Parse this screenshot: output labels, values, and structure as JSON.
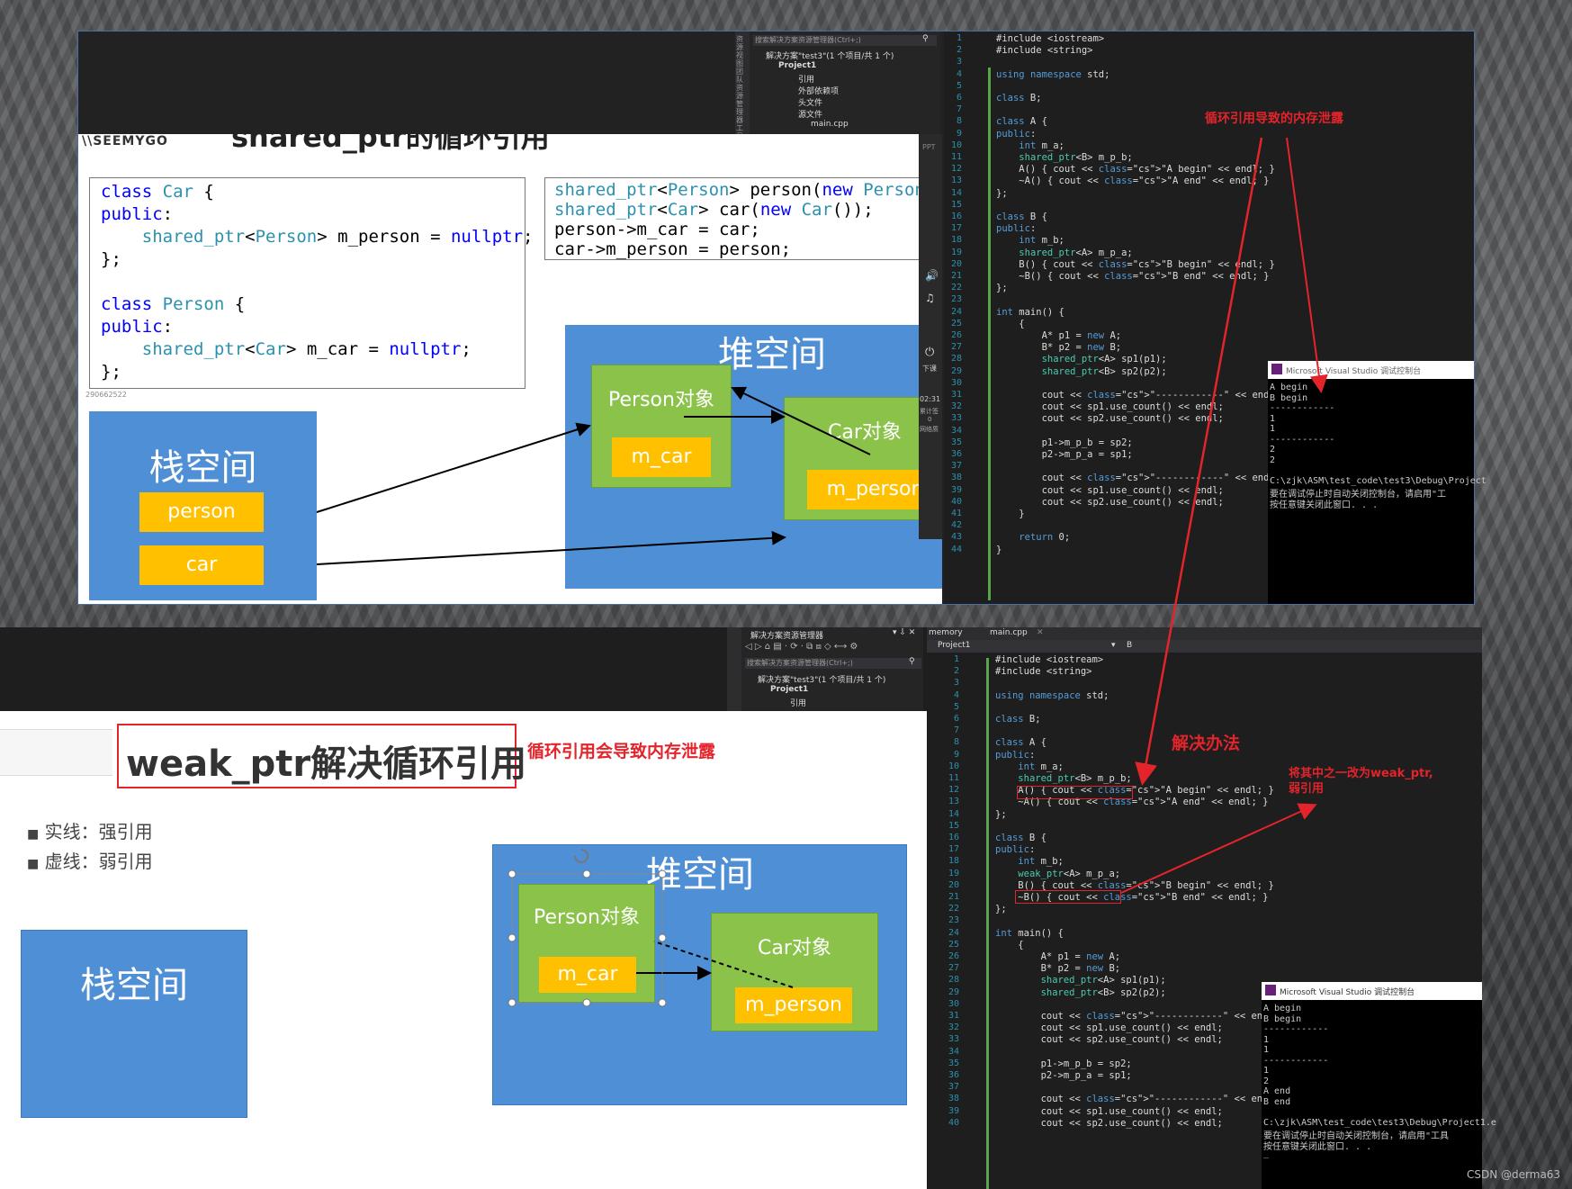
{
  "top": {
    "slide": {
      "title_fragment": "shared_ptr的循环引用",
      "watermark": "\\\\SEEMYGO",
      "code_left": [
        "class Car {",
        "public:",
        "    shared_ptr<Person> m_person = nullptr;",
        "};",
        "",
        "class Person {",
        "public:",
        "    shared_ptr<Car> m_car = nullptr;",
        "};"
      ],
      "code_right": [
        "shared_ptr<Person> person(new Person",
        "shared_ptr<Car> car(new Car());",
        "person->m_car = car;",
        "car->m_person = person;"
      ],
      "small_id": "290662522",
      "heap_label": "堆空间",
      "stack_label": "栈空间",
      "person_obj": "Person对象",
      "car_obj": "Car对象",
      "m_car": "m_car",
      "m_person": "m_person",
      "stack_person": "person",
      "stack_car": "car"
    },
    "side_toolbar": {
      "time": "02:31",
      "labels": [
        "PPT",
        "下课",
        "累计签",
        "0",
        "网络质"
      ]
    },
    "solution_explorer": {
      "search": "搜索解决方案资源管理器(Ctrl+;)",
      "items": [
        "解决方案\"test3\"(1 个项目/共 1 个)",
        "Project1",
        "引用",
        "外部依赖项",
        "头文件",
        "源文件",
        "main.cpp"
      ],
      "side_tabs": "资源视图 团队资源管理器 工具箱"
    },
    "code_lines": [
      "#include <iostream>",
      "#include <string>",
      "",
      "using namespace std;",
      "",
      "class B;",
      "",
      "class A {",
      "public:",
      "    int m_a;",
      "    shared_ptr<B> m_p_b;",
      "    A() { cout << \"A begin\" << endl; }",
      "    ~A() { cout << \"A end\" << endl; }",
      "};",
      "",
      "class B {",
      "public:",
      "    int m_b;",
      "    shared_ptr<A> m_p_a;",
      "    B() { cout << \"B begin\" << endl; }",
      "    ~B() { cout << \"B end\" << endl; }",
      "};",
      "",
      "int main() {",
      "    {",
      "        A* p1 = new A;",
      "        B* p2 = new B;",
      "        shared_ptr<A> sp1(p1);",
      "        shared_ptr<B> sp2(p2);",
      "",
      "        cout << \"------------\" << endl;",
      "        cout << sp1.use_count() << endl;",
      "        cout << sp2.use_count() << endl;",
      "",
      "        p1->m_p_b = sp2;",
      "        p2->m_p_a = sp1;",
      "",
      "        cout << \"------------\" << endl;",
      "        cout << sp1.use_count() << endl;",
      "        cout << sp2.use_count() << endl;",
      "    }",
      "",
      "    return 0;",
      "}"
    ],
    "console": {
      "title": "Microsoft Visual Studio 调试控制台",
      "lines": [
        "A begin",
        "B begin",
        "------------",
        "1",
        "1",
        "------------",
        "2",
        "2",
        "",
        "C:\\zjk\\ASM\\test_code\\test3\\Debug\\Project",
        "要在调试停止时自动关闭控制台，请启用\"工",
        "按任意键关闭此窗口. . ."
      ]
    },
    "annotation": "循环引用导致的内存泄露"
  },
  "bottom": {
    "slide": {
      "title": "weak_ptr解决循环引用",
      "title_note": "循环引用会导致内存泄露",
      "bullets": [
        "实线：强引用",
        "虚线：弱引用"
      ],
      "heap_label": "堆空间",
      "stack_label": "栈空间",
      "person_obj": "Person对象",
      "car_obj": "Car对象",
      "m_car": "m_car",
      "m_person": "m_person"
    },
    "solution_explorer": {
      "title": "解决方案资源管理器",
      "search": "搜索解决方案资源管理器(Ctrl+;)",
      "items": [
        "解决方案\"test3\"(1 个项目/共 1 个)",
        "Project1",
        "引用"
      ]
    },
    "tabs": [
      "memory",
      "main.cpp"
    ],
    "nav": {
      "project": "Project1",
      "scope": "B"
    },
    "code_lines": [
      "#include <iostream>",
      "#include <string>",
      "",
      "using namespace std;",
      "",
      "class B;",
      "",
      "class A {",
      "public:",
      "    int m_a;",
      "    shared_ptr<B> m_p_b;",
      "    A() { cout << \"A begin\" << endl; }",
      "    ~A() { cout << \"A end\" << endl; }",
      "};",
      "",
      "class B {",
      "public:",
      "    int m_b;",
      "    weak_ptr<A> m_p_a;",
      "    B() { cout << \"B begin\" << endl; }",
      "    ~B() { cout << \"B end\" << endl; }",
      "};",
      "",
      "int main() {",
      "    {",
      "        A* p1 = new A;",
      "        B* p2 = new B;",
      "        shared_ptr<A> sp1(p1);",
      "        shared_ptr<B> sp2(p2);",
      "",
      "        cout << \"------------\" << endl;",
      "        cout << sp1.use_count() << endl;",
      "        cout << sp2.use_count() << endl;",
      "",
      "        p1->m_p_b = sp2;",
      "        p2->m_p_a = sp1;",
      "",
      "        cout << \"------------\" << endl;",
      "        cout << sp1.use_count() << endl;",
      "        cout << sp2.use_count() << endl;"
    ],
    "console": {
      "title": "Microsoft Visual Studio 调试控制台",
      "lines": [
        "A begin",
        "B begin",
        "------------",
        "1",
        "1",
        "------------",
        "1",
        "2",
        "A end",
        "B end",
        "",
        "C:\\zjk\\ASM\\test_code\\test3\\Debug\\Project1.e",
        "要在调试停止时自动关闭控制台，请启用\"工具",
        "按任意键关闭此窗口. . .",
        "_"
      ]
    },
    "annotation_solution": "解决办法",
    "annotation_change": "将其中之一改为weak_ptr,\n弱引用"
  },
  "watermark": "CSDN @derma63",
  "colors": {
    "annotation": "#e3242b",
    "heap": "#4f8fd6",
    "object": "#8bc34a",
    "field": "#ffc000"
  }
}
